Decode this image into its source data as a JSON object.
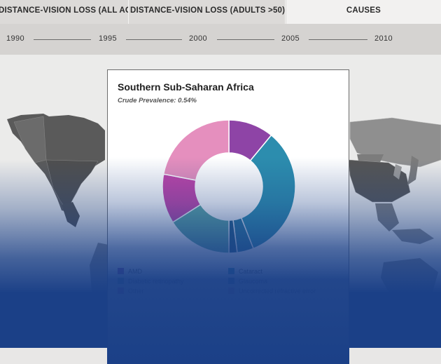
{
  "tabs": [
    {
      "label": "DISTANCE-VISION LOSS (ALL AGES)"
    },
    {
      "label": "DISTANCE-VISION LOSS (ADULTS >50)"
    },
    {
      "label": "CAUSES"
    }
  ],
  "timeline": {
    "years": [
      "1990",
      "1995",
      "2000",
      "2005",
      "2010"
    ]
  },
  "card": {
    "title": "Southern Sub-Saharan Africa",
    "subtitle": "Crude Prevalence: 0.54%",
    "chart_data": {
      "type": "pie",
      "values": [
        11,
        33,
        4,
        2,
        16,
        12,
        22
      ],
      "colors": [
        "#8e44a6",
        "#2c8dae",
        "#2a7a9e",
        "#1f5d85",
        "#5aa6a3",
        "#c044a8",
        "#e58fbe"
      ]
    },
    "legend": [
      {
        "label": "AMD",
        "color": "#8e44a6"
      },
      {
        "label": "Cataract",
        "color": "#2c8dae"
      },
      {
        "label": "Diabetic retinopathy",
        "color": "#5aa6a3"
      },
      {
        "label": "Glaucoma",
        "color": "#2a7a9e"
      },
      {
        "label": "Other",
        "color": "#c044a8"
      },
      {
        "label": "Uncorrected refractive error",
        "color": "#e58fbe"
      }
    ]
  }
}
